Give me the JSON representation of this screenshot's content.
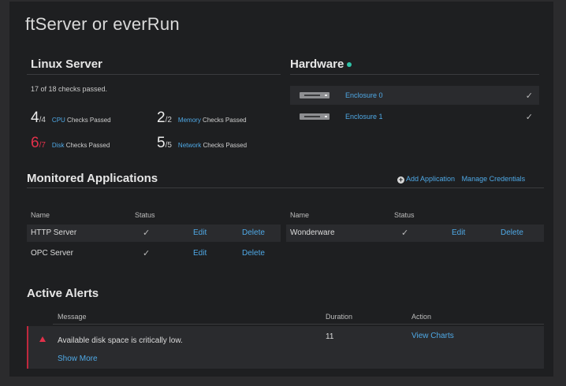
{
  "page": {
    "title": "ftServer or everRun"
  },
  "linux_server": {
    "heading": "Linux Server",
    "summary": "17 of 18 checks passed.",
    "stats": [
      {
        "num": "4",
        "den": "/4",
        "highlight": "CPU",
        "suffix": " Checks Passed",
        "status": "ok"
      },
      {
        "num": "2",
        "den": "/2",
        "highlight": "Memory",
        "suffix": " Checks Passed",
        "status": "ok"
      },
      {
        "num": "6",
        "den": "/7",
        "highlight": "Disk",
        "suffix": " Checks Passed",
        "status": "error"
      },
      {
        "num": "5",
        "den": "/5",
        "highlight": "Network",
        "suffix": " Checks Passed",
        "status": "ok"
      }
    ]
  },
  "hardware": {
    "heading": "Hardware",
    "status_color": "#2fc3a8",
    "enclosures": [
      {
        "name": "Enclosure 0",
        "icon": "drive-icon",
        "status_icon": "check-icon"
      },
      {
        "name": "Enclosure 1",
        "icon": "drive-icon",
        "status_icon": "check-icon"
      }
    ]
  },
  "monitored_apps": {
    "heading": "Monitored Applications",
    "add_label": "Add Application",
    "manage_label": "Manage Credentials",
    "columns": {
      "name": "Name",
      "status": "Status"
    },
    "edit_label": "Edit",
    "delete_label": "Delete",
    "apps_left": [
      {
        "name": "HTTP Server",
        "status_icon": "check-icon"
      },
      {
        "name": "OPC Server",
        "status_icon": "check-icon"
      }
    ],
    "apps_right": [
      {
        "name": "Wonderware",
        "status_icon": "check-icon"
      }
    ]
  },
  "active_alerts": {
    "heading": "Active Alerts",
    "columns": {
      "message": "Message",
      "duration": "Duration",
      "action": "Action"
    },
    "alerts": [
      {
        "message": "Available disk space is critically low.",
        "duration": "11",
        "action": "View Charts",
        "more": "Show More",
        "severity_icon": "warning-triangle-icon"
      }
    ]
  },
  "colors": {
    "accent": "#4fa9e6",
    "error": "#e2314a",
    "ok": "#2fc3a8"
  }
}
